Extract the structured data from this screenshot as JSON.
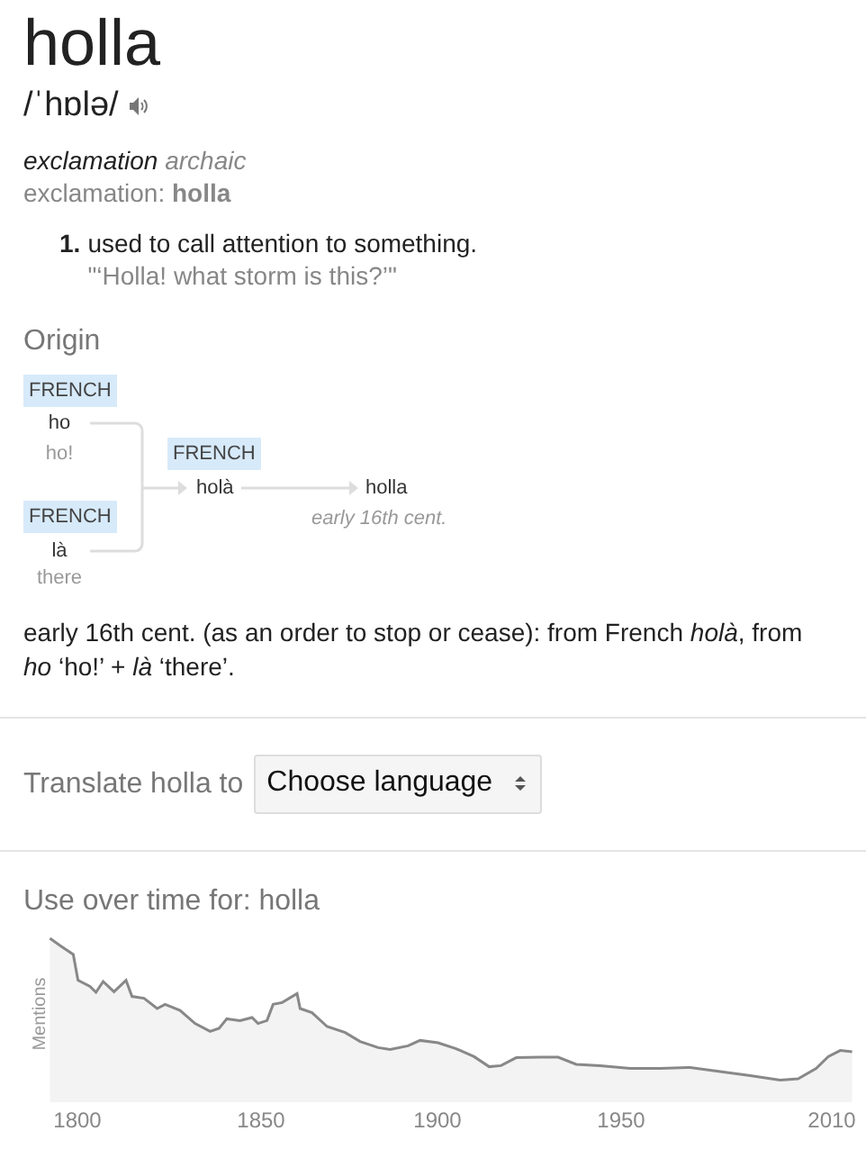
{
  "headword": "holla",
  "pronunciation": "/ˈhɒlə/",
  "part_of_speech": "exclamation",
  "register": "archaic",
  "variant": "exclamation: **holla**",
  "senses": [
    {
      "number": "1.",
      "definition": "used to call attention to something.",
      "example": "\"‘Holla! what storm is this?’\""
    }
  ],
  "origin": {
    "title": "Origin",
    "sources": [
      {
        "language": "FRENCH",
        "word": "ho",
        "gloss": "ho!"
      },
      {
        "language": "FRENCH",
        "word": "là",
        "gloss": "there"
      }
    ],
    "intermediate": {
      "language": "FRENCH",
      "word": "holà"
    },
    "result": {
      "word": "holla",
      "date": "early 16th cent."
    },
    "description": "early 16th cent. (as an order to stop or cease): from French *holà*, from *ho* ‘ho!’ + *là* ‘there’."
  },
  "translate": {
    "label": "Translate holla to",
    "select": "Choose language"
  },
  "usage": {
    "title": "Use over time for: holla",
    "ylabel": "Mentions",
    "xlabels": [
      "1800",
      "1850",
      "1900",
      "1950",
      "2010"
    ]
  }
}
